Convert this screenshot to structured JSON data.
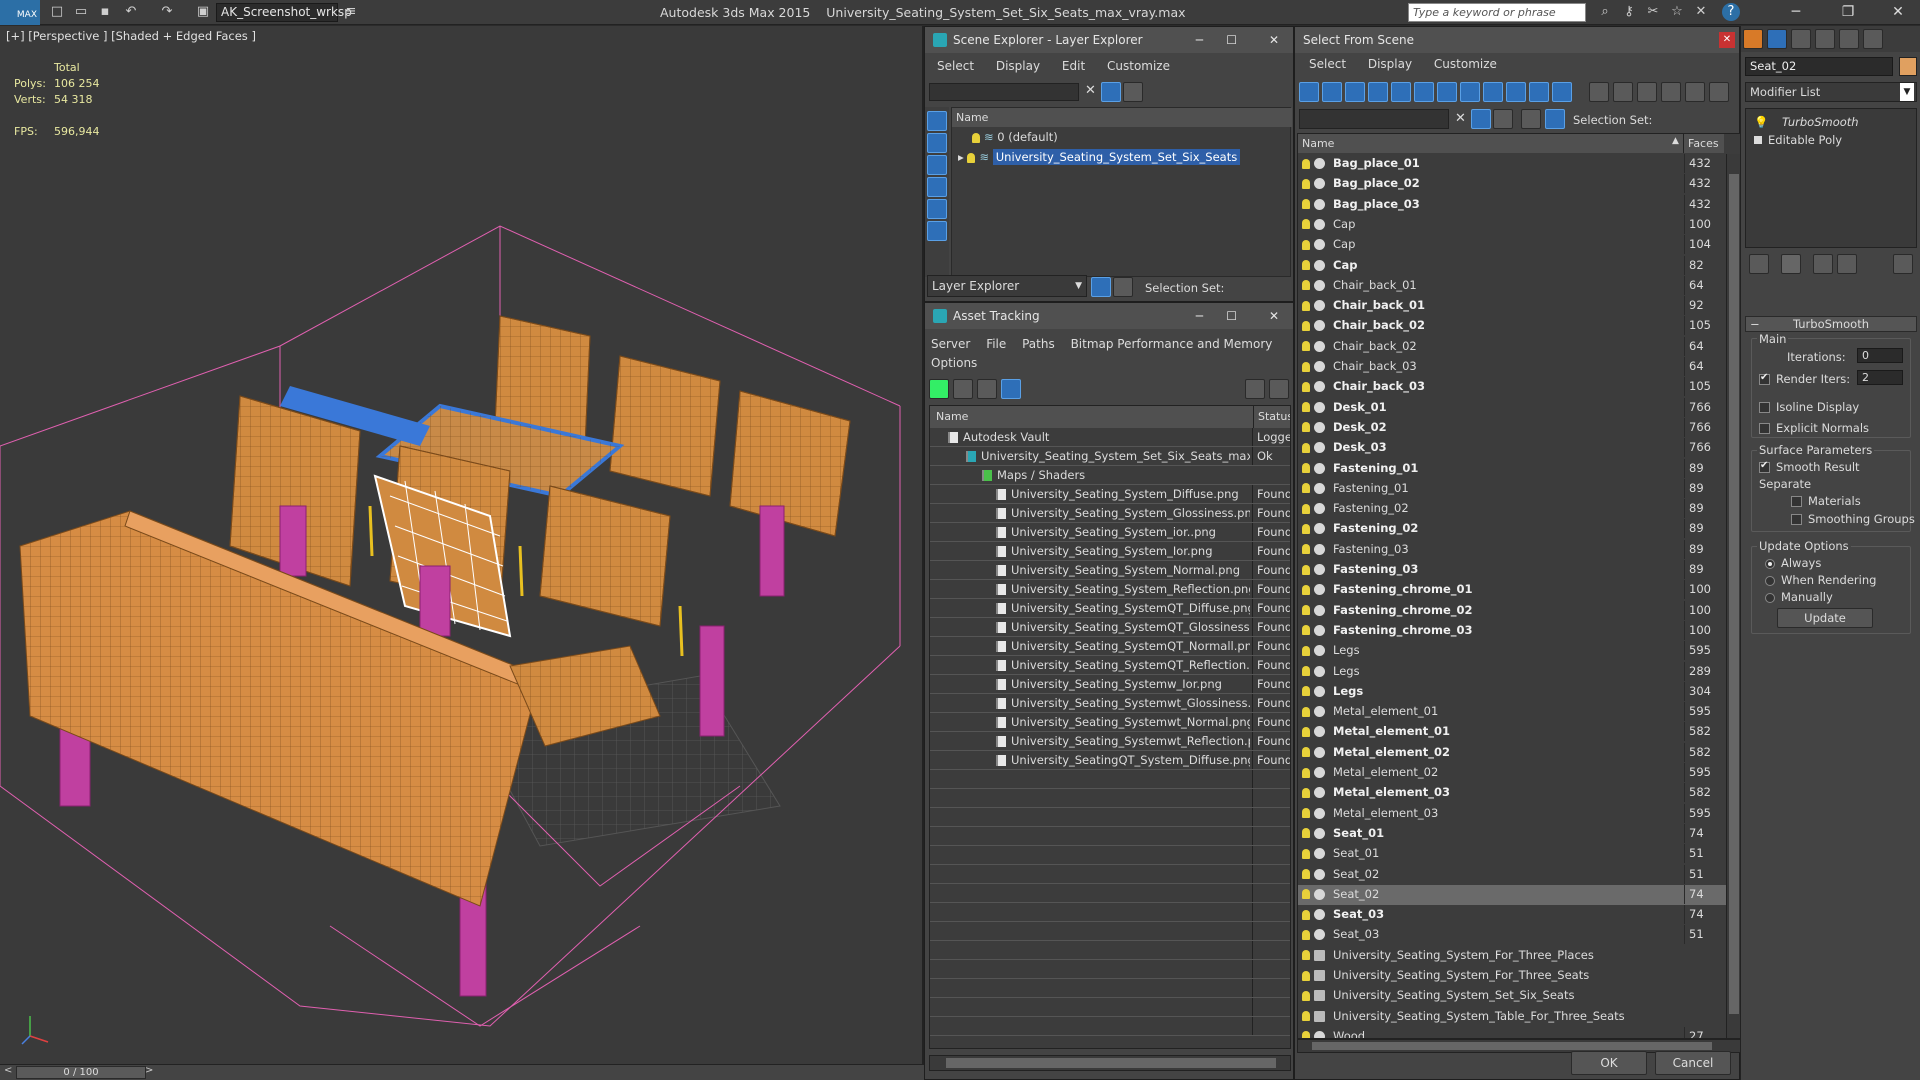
{
  "titlebar": {
    "logo": "MAX",
    "workspace": "AK_Screenshot_wrksp",
    "app_title": "Autodesk 3ds Max  2015",
    "file_title": "University_Seating_System_Set_Six_Seats_max_vray.max",
    "search_placeholder": "Type a keyword or phrase"
  },
  "viewport": {
    "label": "[+] [Perspective ] [Shaded + Edged Faces ]",
    "stats": {
      "total_label": "Total",
      "polys_label": "Polys:",
      "polys_value": "106 254",
      "verts_label": "Verts:",
      "verts_value": "54 318",
      "fps_label": "FPS:",
      "fps_value": "596,944"
    },
    "timeline": "0 / 100"
  },
  "layer_explorer": {
    "title": "Scene Explorer - Layer Explorer",
    "menu": [
      "Select",
      "Display",
      "Edit",
      "Customize"
    ],
    "col_name": "Name",
    "rows": [
      "0 (default)",
      "University_Seating_System_Set_Six_Seats"
    ],
    "footer_combo": "Layer Explorer",
    "selection_set": "Selection Set:"
  },
  "asset_tracking": {
    "title": "Asset Tracking",
    "menu": [
      "Server",
      "File",
      "Paths",
      "Bitmap Performance and Memory",
      "Options"
    ],
    "col_name": "Name",
    "col_status": "Status",
    "rows": [
      {
        "name": "Autodesk Vault",
        "status": "Logged"
      },
      {
        "name": "University_Seating_System_Set_Six_Seats_max_v...",
        "status": "Ok"
      },
      {
        "name": "Maps / Shaders",
        "status": ""
      },
      {
        "name": "University_Seating_System_Diffuse.png",
        "status": "Found"
      },
      {
        "name": "University_Seating_System_Glossiness.png",
        "status": "Found"
      },
      {
        "name": "University_Seating_System_ior..png",
        "status": "Found"
      },
      {
        "name": "University_Seating_System_Ior.png",
        "status": "Found"
      },
      {
        "name": "University_Seating_System_Normal.png",
        "status": "Found"
      },
      {
        "name": "University_Seating_System_Reflection.png",
        "status": "Found"
      },
      {
        "name": "University_Seating_SystemQT_Diffuse.png",
        "status": "Found"
      },
      {
        "name": "University_Seating_SystemQT_Glossiness.p...",
        "status": "Found"
      },
      {
        "name": "University_Seating_SystemQT_Normall.png",
        "status": "Found"
      },
      {
        "name": "University_Seating_SystemQT_Reflection.p...",
        "status": "Found"
      },
      {
        "name": "University_Seating_Systemw_Ior.png",
        "status": "Found"
      },
      {
        "name": "University_Seating_Systemwt_Glossiness.p...",
        "status": "Found"
      },
      {
        "name": "University_Seating_Systemwt_Normal.png",
        "status": "Found"
      },
      {
        "name": "University_Seating_Systemwt_Reflection.p...",
        "status": "Found"
      },
      {
        "name": "University_SeatingQT_System_Diffuse.png",
        "status": "Found"
      }
    ]
  },
  "select_from_scene": {
    "title": "Select From Scene",
    "menu": [
      "Select",
      "Display",
      "Customize"
    ],
    "selection_set": "Selection Set:",
    "col_name": "Name",
    "col_faces": "Faces",
    "rows": [
      {
        "name": "Bag_place_01",
        "bold": true,
        "faces": "432"
      },
      {
        "name": "Bag_place_02",
        "bold": true,
        "faces": "432"
      },
      {
        "name": "Bag_place_03",
        "bold": true,
        "faces": "432"
      },
      {
        "name": "Cap",
        "bold": false,
        "faces": "100"
      },
      {
        "name": "Cap",
        "bold": false,
        "faces": "104"
      },
      {
        "name": "Cap",
        "bold": true,
        "faces": "82"
      },
      {
        "name": "Chair_back_01",
        "bold": false,
        "faces": "64"
      },
      {
        "name": "Chair_back_01",
        "bold": true,
        "faces": "92"
      },
      {
        "name": "Chair_back_02",
        "bold": true,
        "faces": "105"
      },
      {
        "name": "Chair_back_02",
        "bold": false,
        "faces": "64"
      },
      {
        "name": "Chair_back_03",
        "bold": false,
        "faces": "64"
      },
      {
        "name": "Chair_back_03",
        "bold": true,
        "faces": "105"
      },
      {
        "name": "Desk_01",
        "bold": true,
        "faces": "766"
      },
      {
        "name": "Desk_02",
        "bold": true,
        "faces": "766"
      },
      {
        "name": "Desk_03",
        "bold": true,
        "faces": "766"
      },
      {
        "name": "Fastening_01",
        "bold": true,
        "faces": "89"
      },
      {
        "name": "Fastening_01",
        "bold": false,
        "faces": "89"
      },
      {
        "name": "Fastening_02",
        "bold": false,
        "faces": "89"
      },
      {
        "name": "Fastening_02",
        "bold": true,
        "faces": "89"
      },
      {
        "name": "Fastening_03",
        "bold": false,
        "faces": "89"
      },
      {
        "name": "Fastening_03",
        "bold": true,
        "faces": "89"
      },
      {
        "name": "Fastening_chrome_01",
        "bold": true,
        "faces": "100"
      },
      {
        "name": "Fastening_chrome_02",
        "bold": true,
        "faces": "100"
      },
      {
        "name": "Fastening_chrome_03",
        "bold": true,
        "faces": "100"
      },
      {
        "name": "Legs",
        "bold": false,
        "faces": "595"
      },
      {
        "name": "Legs",
        "bold": false,
        "faces": "289"
      },
      {
        "name": "Legs",
        "bold": true,
        "faces": "304"
      },
      {
        "name": "Metal_element_01",
        "bold": false,
        "faces": "595"
      },
      {
        "name": "Metal_element_01",
        "bold": true,
        "faces": "582"
      },
      {
        "name": "Metal_element_02",
        "bold": true,
        "faces": "582"
      },
      {
        "name": "Metal_element_02",
        "bold": false,
        "faces": "595"
      },
      {
        "name": "Metal_element_03",
        "bold": true,
        "faces": "582"
      },
      {
        "name": "Metal_element_03",
        "bold": false,
        "faces": "595"
      },
      {
        "name": "Seat_01",
        "bold": true,
        "faces": "74"
      },
      {
        "name": "Seat_01",
        "bold": false,
        "faces": "51"
      },
      {
        "name": "Seat_02",
        "bold": false,
        "faces": "51"
      },
      {
        "name": "Seat_02",
        "bold": false,
        "faces": "74",
        "selected": true
      },
      {
        "name": "Seat_03",
        "bold": true,
        "faces": "74"
      },
      {
        "name": "Seat_03",
        "bold": false,
        "faces": "51"
      },
      {
        "name": "University_Seating_System_For_Three_Places",
        "bold": false,
        "faces": "",
        "group": true
      },
      {
        "name": "University_Seating_System_For_Three_Seats",
        "bold": false,
        "faces": "",
        "group": true
      },
      {
        "name": "University_Seating_System_Set_Six_Seats",
        "bold": false,
        "faces": "",
        "group": true
      },
      {
        "name": "University_Seating_System_Table_For_Three_Seats",
        "bold": false,
        "faces": "",
        "group": true
      },
      {
        "name": "Wood",
        "bold": false,
        "faces": "27"
      }
    ],
    "ok": "OK",
    "cancel": "Cancel"
  },
  "modify_panel": {
    "object_name": "Seat_02",
    "modifier_list": "Modifier List",
    "stack": [
      "TurboSmooth",
      "Editable Poly"
    ],
    "rollout_title": "TurboSmooth",
    "main_label": "Main",
    "iterations_label": "Iterations:",
    "iterations_value": "0",
    "render_iters_label": "Render Iters:",
    "render_iters_value": "2",
    "isoline": "Isoline Display",
    "explicit_normals": "Explicit Normals",
    "surface_params": "Surface Parameters",
    "smooth_result": "Smooth Result",
    "separate": "Separate",
    "materials": "Materials",
    "smoothing_groups": "Smoothing Groups",
    "update_options": "Update Options",
    "always": "Always",
    "when_rendering": "When Rendering",
    "manually": "Manually",
    "update_btn": "Update"
  }
}
